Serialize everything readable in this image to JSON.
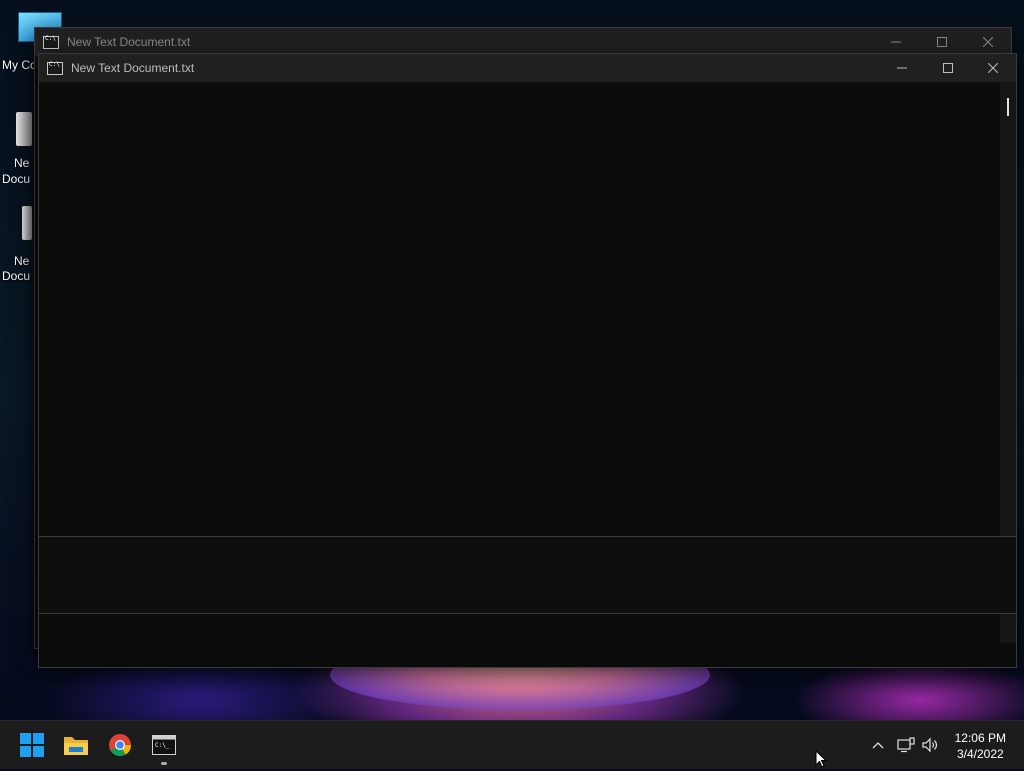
{
  "desktop": {
    "icons": [
      {
        "name": "my-computer",
        "label": "My Co"
      },
      {
        "name": "new-document-1",
        "label_line1": "Ne",
        "label_line2": "Docu"
      },
      {
        "name": "new-document-2",
        "label_line1": "Ne",
        "label_line2": "Docu"
      }
    ]
  },
  "windows": {
    "back": {
      "title": "New Text Document.txt",
      "icon": "console-icon"
    },
    "front": {
      "title": "New Text Document.txt",
      "icon": "console-icon",
      "background_color": "#0c0c0c"
    }
  },
  "taskbar": {
    "apps": [
      {
        "name": "start-button",
        "icon": "windows-logo-icon"
      },
      {
        "name": "file-explorer-button",
        "icon": "folder-icon"
      },
      {
        "name": "chrome-button",
        "icon": "chrome-icon"
      },
      {
        "name": "terminal-button",
        "icon": "console-icon",
        "active": true
      }
    ],
    "tray": {
      "icons": [
        "chevron-up-icon",
        "network-icon",
        "volume-icon"
      ]
    },
    "clock": {
      "time": "12:06 PM",
      "date": "3/4/2022"
    }
  },
  "colors": {
    "accent": "#0078d4",
    "titlebar": "#202020",
    "taskbar": "#1c1c1c"
  }
}
